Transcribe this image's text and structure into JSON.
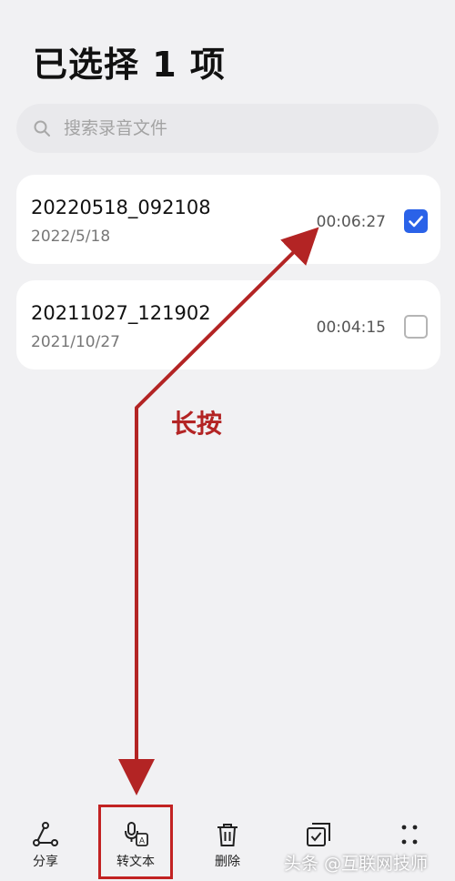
{
  "header": {
    "title": "已选择 1 项"
  },
  "search": {
    "placeholder": "搜索录音文件",
    "icon": "search-icon"
  },
  "recordings": [
    {
      "name": "20220518_092108",
      "date": "2022/5/18",
      "duration": "00:06:27",
      "checked": true
    },
    {
      "name": "20211027_121902",
      "date": "2021/10/27",
      "duration": "00:04:15",
      "checked": false
    }
  ],
  "annotation": {
    "text": "长按",
    "color": "#b32424"
  },
  "toolbar": {
    "share_label": "分享",
    "transcribe_label": "转文本",
    "delete_label": "删除",
    "select_all_label": "",
    "more_label": ""
  },
  "watermark": {
    "text": "头条 @互联网技师"
  },
  "colors": {
    "accent": "#2a62e8",
    "background": "#f1f1f3",
    "annotation": "#c22222"
  }
}
